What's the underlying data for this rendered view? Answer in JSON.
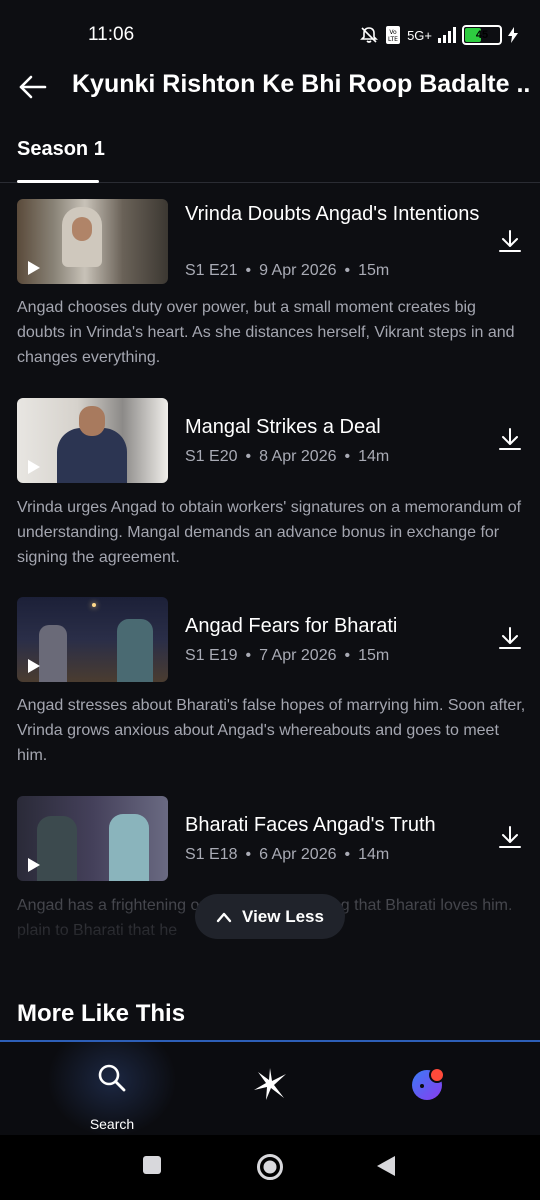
{
  "status_bar": {
    "time": "11:06",
    "network": "5G+",
    "battery": "45",
    "icons": [
      "mute-icon",
      "volte-icon",
      "signal-icon",
      "battery-icon",
      "charging-icon"
    ]
  },
  "header": {
    "title": "Kyunki Rishton Ke Bhi Roop Badalte ...",
    "back_icon": "arrow-left-icon"
  },
  "tabs": [
    {
      "label": "Season 1",
      "active": true
    }
  ],
  "episodes": [
    {
      "title": "Vrinda Doubts Angad's Intentions",
      "code": "S1 E21",
      "date": "9 Apr 2026",
      "duration": "15m",
      "description": "Angad chooses duty over power, but a small moment creates big doubts in Vrinda's heart. As she distances herself, Vikrant steps in and changes everything."
    },
    {
      "title": "Mangal Strikes a Deal",
      "code": "S1 E20",
      "date": "8 Apr 2026",
      "duration": "14m",
      "description": "Vrinda urges Angad to obtain workers' signatures on a memorandum of understanding. Mangal demands an advance bonus in exchange for signing the agreement."
    },
    {
      "title": "Angad Fears for Bharati",
      "code": "S1 E19",
      "date": "7 Apr 2026",
      "duration": "15m",
      "description": "Angad stresses about Bharati's false hopes of marrying him. Soon after, Vrinda grows anxious about Angad's whereabouts and goes to meet him."
    },
    {
      "title": "Bharati Faces Angad's Truth",
      "code": "S1 E18",
      "date": "6 Apr 2026",
      "duration": "14m",
      "description": "Angad has a frightening outburst upon learning that Bharati loves him. plain to Bharati that he"
    }
  ],
  "view_less": {
    "label": "View Less",
    "icon": "chevron-up-icon"
  },
  "more_like_this": {
    "title": "More Like This"
  },
  "bottom_nav": {
    "items": [
      {
        "label": "Search",
        "icon": "search-icon",
        "active": true
      },
      {
        "label": "",
        "icon": "sparkle-icon",
        "active": false
      },
      {
        "label": "",
        "icon": "profile-avatar-icon",
        "active": false
      }
    ]
  },
  "colors": {
    "background": "#0d0e12",
    "accent": "#2d5fb8",
    "meta_text": "#a9abb5"
  }
}
